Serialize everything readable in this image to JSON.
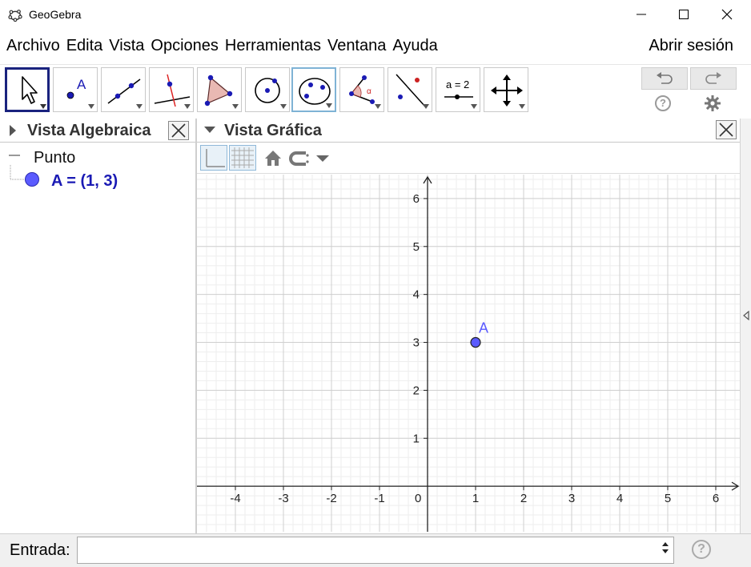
{
  "window": {
    "title": "GeoGebra",
    "icon": "geogebra-logo-icon"
  },
  "menu": {
    "items": [
      "Archivo",
      "Edita",
      "Vista",
      "Opciones",
      "Herramientas",
      "Ventana",
      "Ayuda"
    ],
    "signin": "Abrir sesión"
  },
  "toolbar": {
    "tools": [
      {
        "name": "move-tool-icon"
      },
      {
        "name": "point-tool-icon",
        "label": "A"
      },
      {
        "name": "line-tool-icon"
      },
      {
        "name": "perpendicular-line-tool-icon"
      },
      {
        "name": "polygon-tool-icon"
      },
      {
        "name": "circle-center-point-tool-icon"
      },
      {
        "name": "circle-three-points-tool-icon"
      },
      {
        "name": "angle-tool-icon",
        "label": "α"
      },
      {
        "name": "reflect-tool-icon"
      },
      {
        "name": "slider-tool-icon",
        "label": "a = 2"
      },
      {
        "name": "move-graphics-view-tool-icon"
      }
    ],
    "undo_icon": "undo-icon",
    "redo_icon": "redo-icon",
    "help_icon": "help-icon",
    "settings_icon": "gear-icon"
  },
  "algebra_view": {
    "title": "Vista Algebraica",
    "group_label": "Punto",
    "items": [
      {
        "text": "A = (1, 3)",
        "color": "#5b5bff"
      }
    ]
  },
  "graphics_view": {
    "title": "Vista Gráfica",
    "style_bar": [
      "axes-toggle-icon",
      "grid-toggle-icon",
      "home-icon",
      "point-capture-icon",
      "dropdown-icon"
    ],
    "x_ticks": [
      "-4",
      "-3",
      "-2",
      "-1",
      "0",
      "1",
      "2",
      "3",
      "4",
      "5",
      "6"
    ],
    "y_ticks": [
      "1",
      "2",
      "3",
      "4",
      "5",
      "6"
    ],
    "points": [
      {
        "label": "A",
        "x": 1,
        "y": 3,
        "color": "#5b5bff"
      }
    ],
    "xlim": [
      -4.8,
      6.5
    ],
    "ylim": [
      -0.95,
      6.5
    ]
  },
  "input_bar": {
    "label": "Entrada:",
    "value": "",
    "help_icon": "help-icon"
  }
}
